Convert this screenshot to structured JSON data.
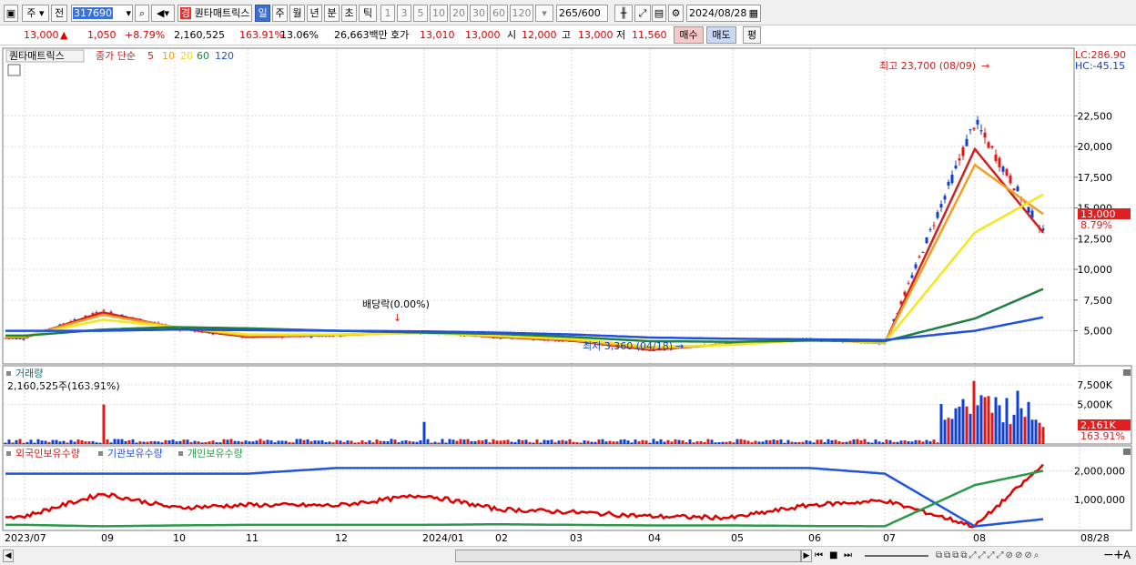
{
  "toolbar": {
    "mode_label": "주",
    "front_label": "전",
    "code": "317690",
    "stock_name": "퀀타매트릭스",
    "stock_prefix": "경",
    "periods": [
      "일",
      "주",
      "월",
      "년",
      "분",
      "초",
      "틱"
    ],
    "selected_period": "일",
    "minutes": [
      "1",
      "3",
      "5",
      "10",
      "20",
      "30",
      "60",
      "120"
    ],
    "count": "265",
    "count_total": "/600",
    "date": "2024/08/28"
  },
  "quote": {
    "price": "13,000",
    "arrow": "▲",
    "change": "1,050",
    "change_pct": "+8.79%",
    "volume": "2,160,525",
    "volume_ratio": "163.91%",
    "turnover": "13.06%",
    "amount": "26,663백만",
    "hoga_label": "호가",
    "bid": "13,010",
    "ask": "13,000",
    "open_label": "시",
    "open": "12,000",
    "high_label": "고",
    "high": "13,000",
    "low_label": "저",
    "low": "11,560",
    "buy_label": "매수",
    "sell_label": "매도",
    "eval_label": "평"
  },
  "price_panel": {
    "name_tag": "퀀타매트릭스",
    "legend_prefix": "종가 단순",
    "lc": "LC:286.90",
    "hc": "HC:-45.15",
    "current_tag": "13,000",
    "current_pct": "8.79%",
    "max_annotation": "최고 23,700 (08/09)",
    "min_annotation": "최저 3,360 (04/18)",
    "dividend_annotation": "배당락(0.00%)"
  },
  "volume_panel": {
    "title": "거래량",
    "readout": "2,160,525주(163.91%)",
    "current_tag": "2,161K",
    "current_pct": "163.91%"
  },
  "holdings_panel": {
    "series": [
      {
        "name": "외국인보유수량",
        "color": "#e00000"
      },
      {
        "name": "기관보유수량",
        "color": "#2255dd"
      },
      {
        "name": "개인보유수량",
        "color": "#2a9a4a"
      }
    ]
  },
  "x_axis": {
    "labels": [
      "2023/07",
      "09",
      "10",
      "11",
      "12",
      "2024/01",
      "02",
      "03",
      "04",
      "05",
      "06",
      "07",
      "08"
    ],
    "end_label": "08/28"
  },
  "chart_data": [
    {
      "type": "line",
      "title": "퀀타매트릭스 일봉",
      "x_labels": [
        "2023/07",
        "09",
        "10",
        "11",
        "12",
        "2024/01",
        "02",
        "03",
        "04",
        "05",
        "06",
        "07",
        "08"
      ],
      "y_ticks": [
        5000,
        7500,
        10000,
        12500,
        15000,
        17500,
        20000,
        22500
      ],
      "ylim": [
        2300,
        24300
      ],
      "series": [
        {
          "name": "종가",
          "color": "#d02020",
          "x": [
            "2023/07",
            "09",
            "10",
            "11",
            "12",
            "2024/01",
            "02",
            "03",
            "04",
            "05",
            "06",
            "07",
            "08",
            "08/28"
          ],
          "values": [
            4400,
            6600,
            5200,
            4500,
            4650,
            4900,
            4500,
            4200,
            3400,
            4000,
            4300,
            4000,
            22000,
            13000
          ]
        },
        {
          "name": "5",
          "color": "#d02020",
          "x": [
            "2023/07",
            "09",
            "10",
            "11",
            "12",
            "2024/01",
            "02",
            "03",
            "04",
            "05",
            "06",
            "07",
            "08",
            "08/28"
          ],
          "values": [
            4450,
            6500,
            5250,
            4500,
            4650,
            4900,
            4500,
            4200,
            3450,
            3950,
            4300,
            4000,
            19800,
            13000
          ]
        },
        {
          "name": "10",
          "color": "#f0a020",
          "x": [
            "2023/07",
            "09",
            "10",
            "11",
            "12",
            "2024/01",
            "02",
            "03",
            "04",
            "05",
            "06",
            "07",
            "08",
            "08/28"
          ],
          "values": [
            4500,
            6300,
            5300,
            4600,
            4650,
            4850,
            4550,
            4250,
            3550,
            3900,
            4300,
            4000,
            18500,
            14500
          ]
        },
        {
          "name": "20",
          "color": "#f5e61e",
          "x": [
            "2023/07",
            "09",
            "10",
            "11",
            "12",
            "2024/01",
            "02",
            "03",
            "04",
            "05",
            "06",
            "07",
            "08",
            "08/28"
          ],
          "values": [
            4550,
            5900,
            5300,
            4700,
            4700,
            4800,
            4600,
            4350,
            3700,
            3850,
            4250,
            4050,
            13000,
            16100
          ]
        },
        {
          "name": "60",
          "color": "#208040",
          "x": [
            "2023/07",
            "09",
            "10",
            "11",
            "12",
            "2024/01",
            "02",
            "03",
            "04",
            "05",
            "06",
            "07",
            "08",
            "08/28"
          ],
          "values": [
            4600,
            5100,
            5300,
            5200,
            5000,
            4850,
            4750,
            4500,
            4150,
            4100,
            4200,
            4150,
            6000,
            8400
          ]
        },
        {
          "name": "120",
          "color": "#2050e0",
          "x": [
            "2023/07",
            "09",
            "10",
            "11",
            "12",
            "2024/01",
            "02",
            "03",
            "04",
            "05",
            "06",
            "07",
            "08",
            "08/28"
          ],
          "values": [
            5000,
            5000,
            5100,
            5050,
            5000,
            4950,
            4850,
            4700,
            4450,
            4350,
            4300,
            4250,
            5000,
            6100
          ]
        }
      ]
    },
    {
      "type": "bar",
      "title": "거래량",
      "y_ticks": [
        "5,000K",
        "7,500K"
      ],
      "ylim": [
        0,
        9000
      ],
      "y_unit": "K",
      "highlights": [
        {
          "x": "09",
          "value": 5000
        },
        {
          "x": "2024/01",
          "value": 2800
        },
        {
          "x": "08",
          "value": 8000
        },
        {
          "x": "08/28",
          "value": 2161
        }
      ]
    },
    {
      "type": "line",
      "title": "보유수량",
      "y_ticks": [
        "1,000,000",
        "2,000,000"
      ],
      "ylim": [
        0,
        2400000
      ],
      "series": [
        {
          "name": "외국인보유수량",
          "x": [
            "2023/07",
            "09",
            "10",
            "11",
            "12",
            "2024/01",
            "02",
            "03",
            "04",
            "05",
            "06",
            "07",
            "08",
            "08/28"
          ],
          "values": [
            400000,
            1200000,
            700000,
            800000,
            780000,
            1150000,
            650000,
            550000,
            400000,
            350000,
            800000,
            950000,
            50000,
            2200000
          ]
        },
        {
          "name": "기관보유수량",
          "x": [
            "2023/07",
            "09",
            "10",
            "11",
            "12",
            "2024/01",
            "02",
            "03",
            "04",
            "05",
            "06",
            "07",
            "08",
            "08/28"
          ],
          "values": [
            1900000,
            1900000,
            1900000,
            1900000,
            2100000,
            2100000,
            2100000,
            2100000,
            2100000,
            2100000,
            2100000,
            1900000,
            50000,
            300000
          ]
        },
        {
          "name": "개인보유수량",
          "x": [
            "2023/07",
            "09",
            "10",
            "11",
            "12",
            "2024/01",
            "02",
            "03",
            "04",
            "05",
            "06",
            "07",
            "08",
            "08/28"
          ],
          "values": [
            100000,
            50000,
            80000,
            100000,
            100000,
            100000,
            120000,
            100000,
            80000,
            80000,
            60000,
            50000,
            1500000,
            2000000
          ]
        }
      ]
    }
  ]
}
